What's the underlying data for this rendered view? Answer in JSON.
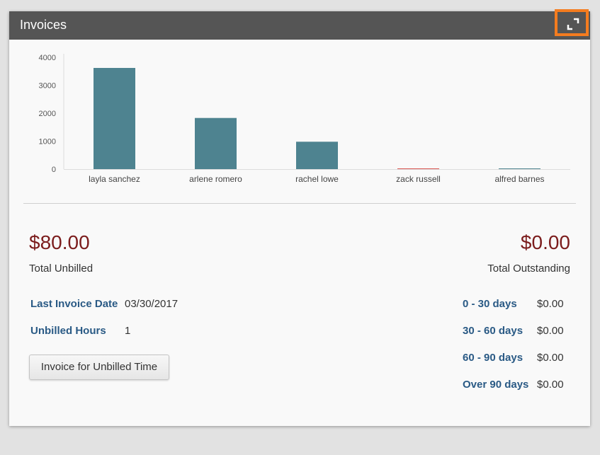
{
  "header": {
    "title": "Invoices",
    "expand_icon": "expand-icon",
    "highlight_color": "#f47c1f"
  },
  "chart_data": {
    "type": "bar",
    "categories": [
      "layla sanchez",
      "arlene romero",
      "rachel lowe",
      "zack russell",
      "alfred barnes"
    ],
    "values": [
      3620,
      1830,
      980,
      15,
      10
    ],
    "bar_colors": [
      "#4e8390",
      "#4e8390",
      "#4e8390",
      "#d9534f",
      "#4e8390"
    ],
    "yticks": [
      0,
      1000,
      2000,
      3000,
      4000
    ],
    "ylim": [
      0,
      4000
    ],
    "title": "",
    "xlabel": "",
    "ylabel": ""
  },
  "summary": {
    "unbilled_amount": "$80.00",
    "unbilled_label": "Total Unbilled",
    "outstanding_amount": "$0.00",
    "outstanding_label": "Total Outstanding"
  },
  "details": {
    "last_invoice_label": "Last Invoice Date",
    "last_invoice_value": "03/30/2017",
    "unbilled_hours_label": "Unbilled Hours",
    "unbilled_hours_value": "1"
  },
  "actions": {
    "invoice_button": "Invoice for Unbilled Time"
  },
  "aging": [
    {
      "label": "0 - 30 days",
      "value": "$0.00"
    },
    {
      "label": "30 - 60 days",
      "value": "$0.00"
    },
    {
      "label": "60 - 90 days",
      "value": "$0.00"
    },
    {
      "label": "Over 90 days",
      "value": "$0.00"
    }
  ],
  "colors": {
    "amount": "#7b1c1c",
    "link": "#2a5a85",
    "header_bg": "#555555",
    "bar": "#4e8390"
  }
}
